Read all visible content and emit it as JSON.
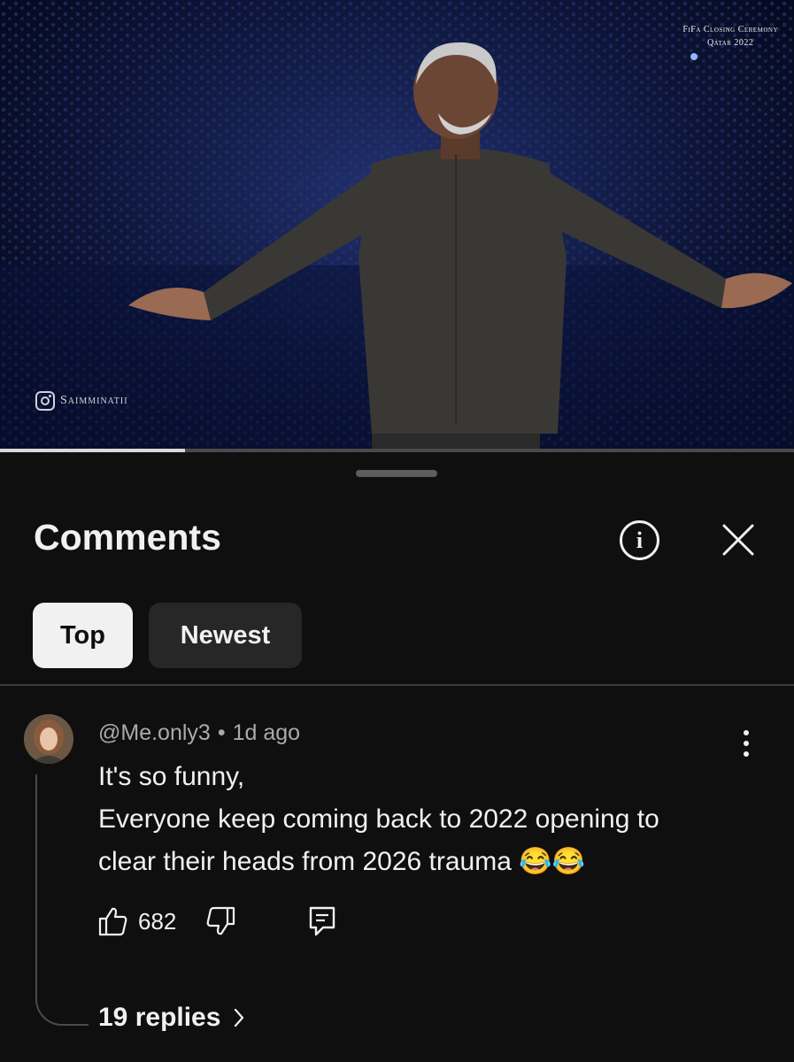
{
  "video": {
    "caption_line1": "FiFa Closing Ceremony",
    "caption_line2": "Qatar 2022",
    "watermark": "Saimminatii",
    "progress_fraction": 0.233
  },
  "sheet": {
    "title": "Comments",
    "info_icon": "info-circle-icon",
    "info_glyph": "i",
    "close_icon": "close-icon"
  },
  "filters": {
    "top": "Top",
    "newest": "Newest",
    "selected": "Top"
  },
  "comment": {
    "author": "@Me.only3",
    "separator": "•",
    "time": "1d ago",
    "lines": [
      "It's so funny,",
      "Everyone keep coming back to 2022 opening to",
      "clear their heads from 2026 trauma 😂😂"
    ],
    "like_count": "682",
    "replies": "19 replies",
    "replies_chevron": "›"
  },
  "colors": {
    "background": "#0f0f0f",
    "chip_selected": "#f1f1f1",
    "chip_unselected": "#272727",
    "secondary_text": "#aaaaaa"
  }
}
